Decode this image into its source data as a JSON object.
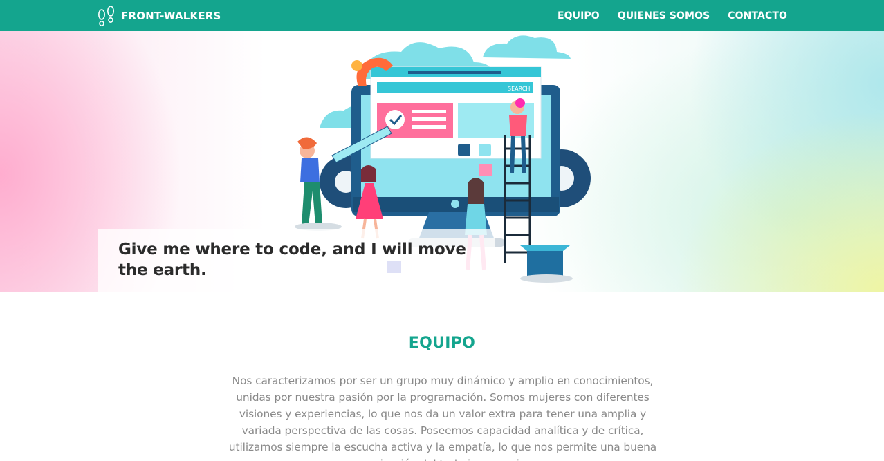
{
  "brand": {
    "name": "FRONT-WALKERS",
    "icon": "footprints-icon"
  },
  "nav": {
    "items": [
      {
        "label": "EQUIPO"
      },
      {
        "label": "QUIENES SOMOS"
      },
      {
        "label": "CONTACTO"
      }
    ]
  },
  "hero": {
    "tagline": "Give me where to code, and I will move the earth.",
    "illustration": {
      "search_label": "SEARCH"
    }
  },
  "team": {
    "title": "EQUIPO",
    "description": "Nos caracterizamos por ser un grupo muy dinámico y amplio en conocimientos, unidas por nuestra pasión por la programación. Somos mujeres con diferentes visiones y experiencias, lo que nos da un valor extra para tener una amplia y variada perspectiva de las cosas. Poseemos capacidad analítica y de crítica, utilizamos siempre la escucha activa y la empatía, lo que nos permite una buena organización del trabajo en equipo."
  },
  "colors": {
    "accent": "#14a58e",
    "text_muted": "#8a8a8a"
  }
}
